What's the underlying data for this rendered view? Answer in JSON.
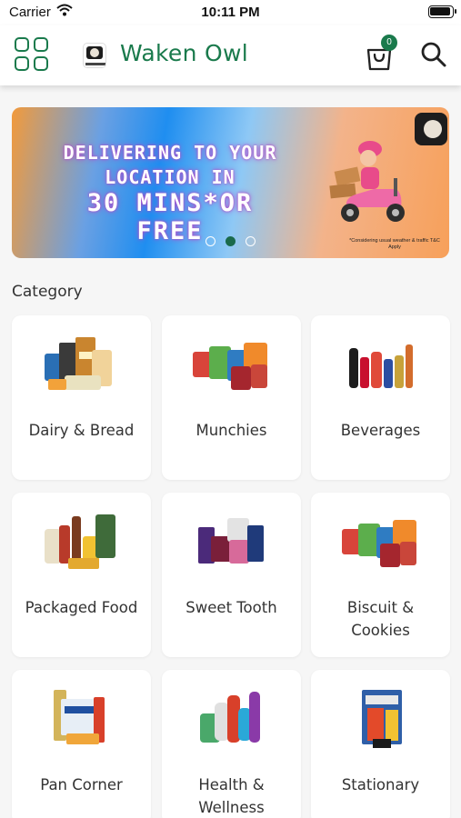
{
  "status_bar": {
    "carrier": "Carrier",
    "time": "10:11 PM"
  },
  "header": {
    "title": "Waken Owl",
    "cart_count": "0"
  },
  "banner": {
    "line1": "DELIVERING TO YOUR",
    "line2": "LOCATION IN",
    "line3": "30 MINS*OR FREE",
    "footnote": "*Considering usual weather & traffic T&C Apply",
    "slide_count": 3,
    "active_slide": 2
  },
  "category": {
    "title": "Category",
    "items": [
      {
        "label": "Dairy & Bread",
        "icon": "dairy-bread-icon"
      },
      {
        "label": "Munchies",
        "icon": "munchies-icon"
      },
      {
        "label": "Beverages",
        "icon": "beverages-icon"
      },
      {
        "label": "Packaged Food",
        "icon": "packaged-food-icon"
      },
      {
        "label": "Sweet Tooth",
        "icon": "sweet-tooth-icon"
      },
      {
        "label": "Biscuit & Cookies",
        "icon": "biscuit-cookies-icon"
      },
      {
        "label": "Pan Corner",
        "icon": "pan-corner-icon"
      },
      {
        "label": "Health & Wellness",
        "icon": "health-wellness-icon"
      },
      {
        "label": "Stationary",
        "icon": "stationary-icon"
      }
    ]
  },
  "colors": {
    "brand": "#1a7a4c",
    "background": "#f6f6f6"
  }
}
